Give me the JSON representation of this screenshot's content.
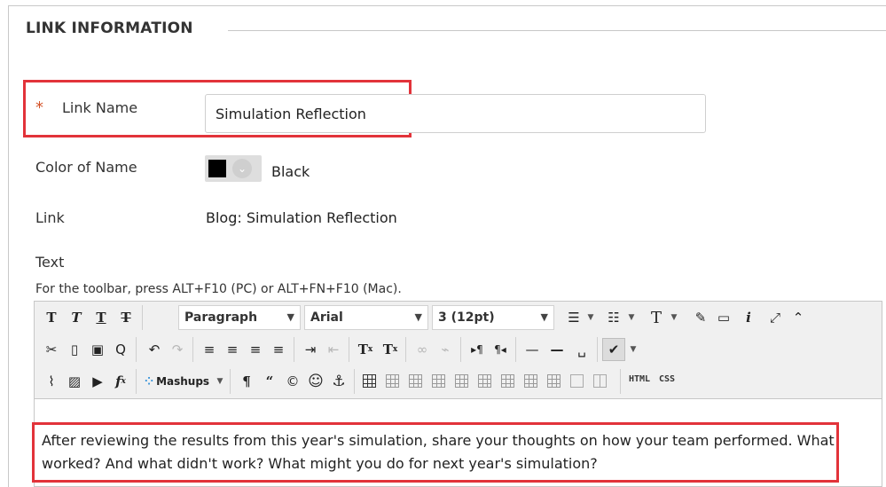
{
  "section": {
    "title": "LINK INFORMATION"
  },
  "form": {
    "link_name_label": "Link Name",
    "link_name_value": "Simulation Reflection",
    "color_label": "Color of Name",
    "color_value_name": "Black",
    "color_value_hex": "#000000",
    "link_label": "Link",
    "link_value": "Blog: Simulation Reflection",
    "text_label": "Text",
    "toolbar_hint": "For the toolbar, press ALT+F10 (PC) or ALT+FN+F10 (Mac)."
  },
  "editor": {
    "format_select": "Paragraph",
    "font_select": "Arial",
    "size_select": "3 (12pt)",
    "mashups_label": "Mashups",
    "html_label": "HTML",
    "css_label": "CSS",
    "content": "After reviewing the results from this year's simulation, share your thoughts on how your team performed. What worked? And what didn't work? What might you do for next year's simulation?"
  },
  "colors": {
    "highlight": "#e2333a",
    "required": "#d4542a"
  }
}
